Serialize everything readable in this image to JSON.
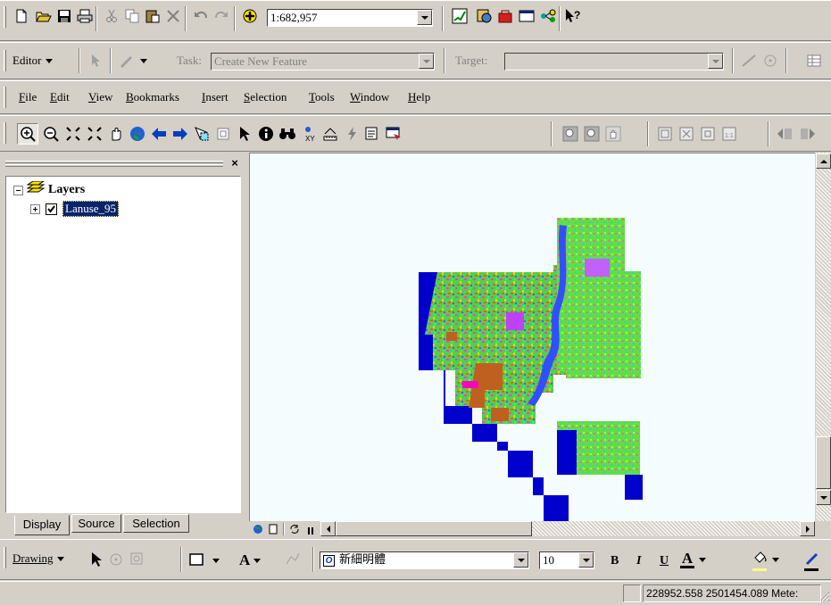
{
  "standard_toolbar": {
    "scale_value": "1:682,957",
    "buttons": [
      "new-icon",
      "open-icon",
      "save-icon",
      "print-icon",
      "cut-icon",
      "copy-icon",
      "paste-icon",
      "delete-icon",
      "undo-icon",
      "redo-icon",
      "add-data-icon",
      "editor-toolbar-icon",
      "arccatalog-icon",
      "arctoolbox-icon",
      "command-line-icon",
      "modelbuilder-icon",
      "whats-this-icon"
    ]
  },
  "editor_toolbar": {
    "editor_label": "Editor",
    "task_label": "Task:",
    "task_value": "Create New Feature",
    "target_label": "Target:",
    "target_value": ""
  },
  "menu": {
    "items": [
      {
        "label": "File",
        "key": "F"
      },
      {
        "label": "Edit",
        "key": "E"
      },
      {
        "label": "View",
        "key": "V"
      },
      {
        "label": "Bookmarks",
        "key": "B"
      },
      {
        "label": "Insert",
        "key": "I"
      },
      {
        "label": "Selection",
        "key": "S"
      },
      {
        "label": "Tools",
        "key": "T"
      },
      {
        "label": "Window",
        "key": "W"
      },
      {
        "label": "Help",
        "key": "H"
      }
    ]
  },
  "toc": {
    "root_label": "Layers",
    "layer_name": "Lanuse_95",
    "layer_checked": true,
    "tabs": [
      "Display",
      "Source",
      "Selection"
    ]
  },
  "drawing_toolbar": {
    "drawing_label": "Drawing",
    "font_name": "新細明體",
    "font_size": "10",
    "bold_label": "B",
    "italic_label": "I",
    "underline_label": "U",
    "font_color_label": "A",
    "text_label": "A"
  },
  "status_bar": {
    "coordinates": "228952.558  2501454.089 Mete:"
  },
  "colors": {
    "window": "#d4d0c8",
    "map_background": "#f5fcfd",
    "selection": "#0a246a",
    "water": "#0000cc"
  }
}
